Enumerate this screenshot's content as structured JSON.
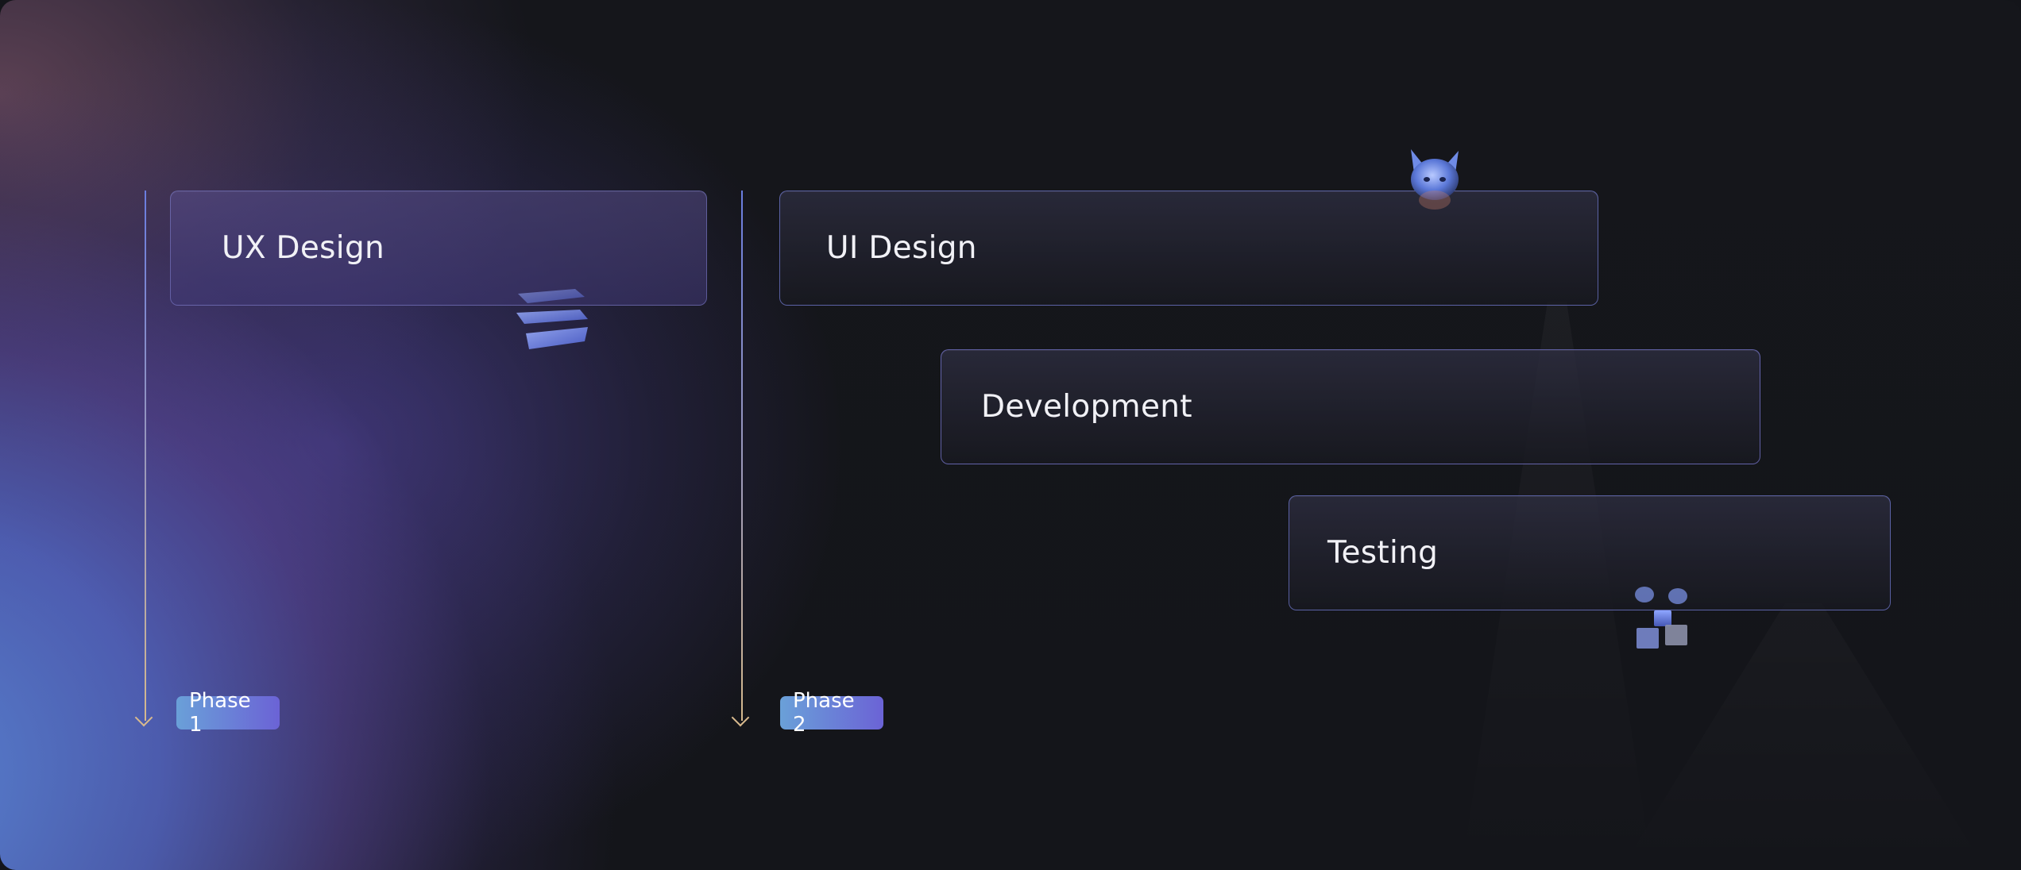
{
  "timeline": {
    "tasks": [
      {
        "label": "UX Design",
        "phase": "Phase 1"
      },
      {
        "label": "UI Design",
        "phase": "Phase 2"
      },
      {
        "label": "Development",
        "phase": "Phase 2"
      },
      {
        "label": "Testing",
        "phase": "Phase 2"
      }
    ],
    "phases": [
      {
        "label": "Phase 1"
      },
      {
        "label": "Phase 2"
      }
    ]
  },
  "decorations": {
    "stack_icon": "stacked-slabs-icon",
    "cat_icon": "cat-head-icon",
    "cubes_icon": "cubes-icon"
  },
  "colors": {
    "background": "#14151a",
    "accent": "#6b63d6",
    "phase_badge_start": "#6aa0d8",
    "axis_arrow": "#d8b98d"
  }
}
